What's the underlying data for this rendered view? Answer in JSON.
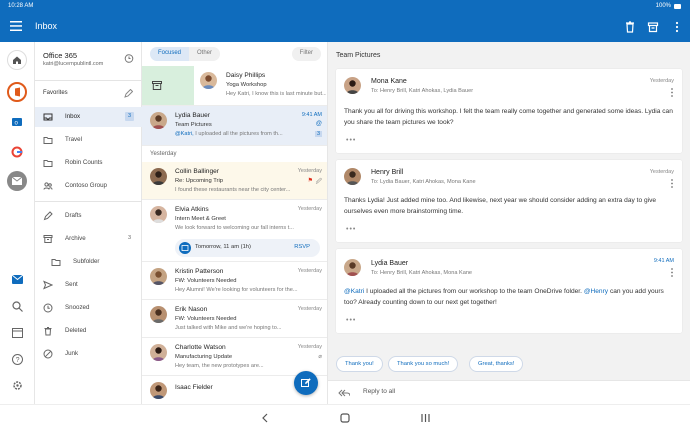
{
  "status": {
    "time": "10:28 AM",
    "battery": "100%"
  },
  "app": {
    "title": "Inbox"
  },
  "account": {
    "name": "Office 365",
    "email": "katri@lucernpublintl.com"
  },
  "folders": {
    "favorites_label": "Favorites",
    "items": [
      {
        "label": "Inbox",
        "count": "3"
      },
      {
        "label": "Travel",
        "count": ""
      },
      {
        "label": "Robin Counts",
        "count": ""
      },
      {
        "label": "Contoso Group",
        "count": ""
      },
      {
        "label": "Drafts",
        "count": ""
      },
      {
        "label": "Archive",
        "count": "3"
      },
      {
        "label": "Subfolder",
        "count": ""
      },
      {
        "label": "Sent",
        "count": ""
      },
      {
        "label": "Snoozed",
        "count": ""
      },
      {
        "label": "Deleted",
        "count": ""
      },
      {
        "label": "Junk",
        "count": ""
      }
    ]
  },
  "list": {
    "tab_focused": "Focused",
    "tab_other": "Other",
    "filter_label": "Filter",
    "yesterday_label": "Yesterday",
    "messages": [
      {
        "from": "Daisy Phillips",
        "subject": "Yoga Workshop",
        "preview": "Hey Katri, I know this is last minute but...",
        "time": ""
      },
      {
        "from": "Lydia Bauer",
        "subject": "Team Pictures",
        "preview_mention": "@Katri,",
        "preview": " I uploaded all the pictures from th...",
        "time": "9:41 AM",
        "count": "3"
      },
      {
        "from": "Collin Ballinger",
        "subject": "Re: Upcoming Trip",
        "preview": "I found these restaurants near the city center...",
        "time": "Yesterday"
      },
      {
        "from": "Elvia Atkins",
        "subject": "Intern Meet & Greet",
        "preview": "We look forward to welcoming our fall interns t...",
        "time": "Yesterday",
        "event_when": "Tomorrow, 11 am (1h)",
        "event_rsvp": "RSVP"
      },
      {
        "from": "Kristin Patterson",
        "subject": "FW: Volunteers Needed",
        "preview": "Hey Alumni! We're looking for volunteers for the...",
        "time": "Yesterday"
      },
      {
        "from": "Erik Nason",
        "subject": "FW: Volunteers Needed",
        "preview": "Just talked with Mike and we're hoping to...",
        "time": "Yesterday"
      },
      {
        "from": "Charlotte Watson",
        "subject": "Manufacturing Update",
        "preview": "Hey team, the new prototypes are...",
        "time": "Yesterday"
      },
      {
        "from": "Isaac Fielder",
        "subject": "",
        "preview": "",
        "time": ""
      }
    ]
  },
  "reading": {
    "title": "Team Pictures",
    "messages": [
      {
        "from": "Mona Kane",
        "to": "To: Henry Brill, Katri Ahokas, Lydia Bauer",
        "time": "Yesterday",
        "body": "Thank you all for driving this workshop. I felt the team really come together and generated some ideas. Lydia can you share the team pictures we took?"
      },
      {
        "from": "Henry Brill",
        "to": "To: Lydia Bauer, Katri Ahokas, Mona Kane",
        "time": "Yesterday",
        "body": "Thanks Lydia! Just added mine too. And likewise, next year we should consider adding an extra day to give ourselves even more brainstorming time."
      },
      {
        "from": "Lydia Bauer",
        "to": "To: Henry Brill, Katri Ahokas, Mona Kane",
        "time": "9:41 AM",
        "mention1": "@Katri",
        "body1": " I uploaded all the pictures from our workshop to the team OneDrive folder. ",
        "mention2": "@Henry",
        "body2": " can you add yours too? Already counting down to our next get together!"
      }
    ],
    "quick_replies": [
      "Thank you!",
      "Thank you so much!",
      "Great, thanks!"
    ],
    "reply_placeholder": "Reply to all",
    "more_dots": "•••"
  },
  "colors": {
    "brand": "#0f6cbd",
    "selected_row": "#e8eef7",
    "flag": "#e0301e"
  }
}
